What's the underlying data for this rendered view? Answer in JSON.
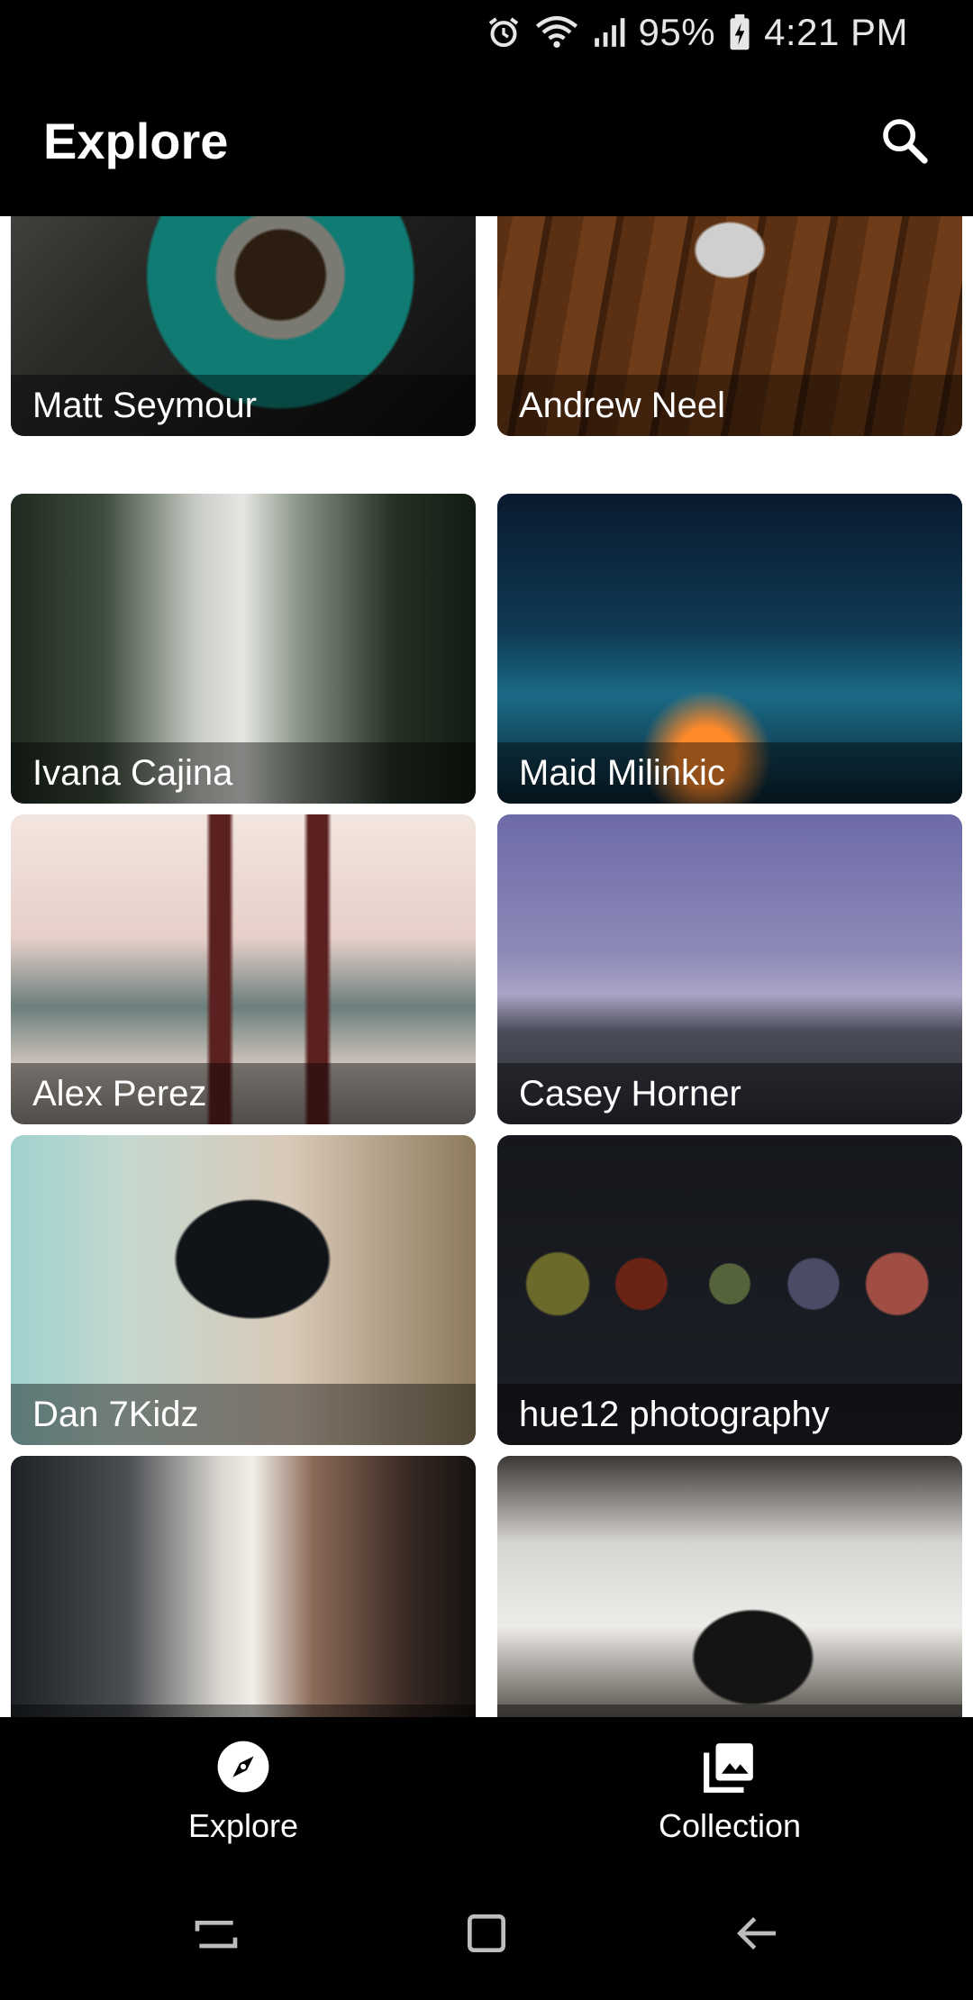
{
  "status_bar": {
    "battery": "95%",
    "time": "4:21 PM",
    "icons": [
      "alarm-icon",
      "wifi-icon",
      "signal-icon",
      "battery-charging-icon"
    ]
  },
  "app_bar": {
    "title": "Explore",
    "search_icon": "search-icon"
  },
  "photos": [
    {
      "author": "Matt Seymour"
    },
    {
      "author": "Andrew Neel"
    },
    {
      "author": "Ivana Cajina"
    },
    {
      "author": "Maid Milinkic"
    },
    {
      "author": "Alex Perez"
    },
    {
      "author": "Casey Horner"
    },
    {
      "author": "Dan 7Kidz"
    },
    {
      "author": "hue12 photography"
    },
    {
      "author": ""
    },
    {
      "author": ""
    }
  ],
  "bottom_nav": {
    "items": [
      {
        "label": "Explore",
        "icon": "compass-icon"
      },
      {
        "label": "Collection",
        "icon": "photo-library-icon"
      }
    ]
  },
  "system_nav": {
    "icons": [
      "recent-apps-icon",
      "home-icon",
      "back-icon"
    ]
  }
}
